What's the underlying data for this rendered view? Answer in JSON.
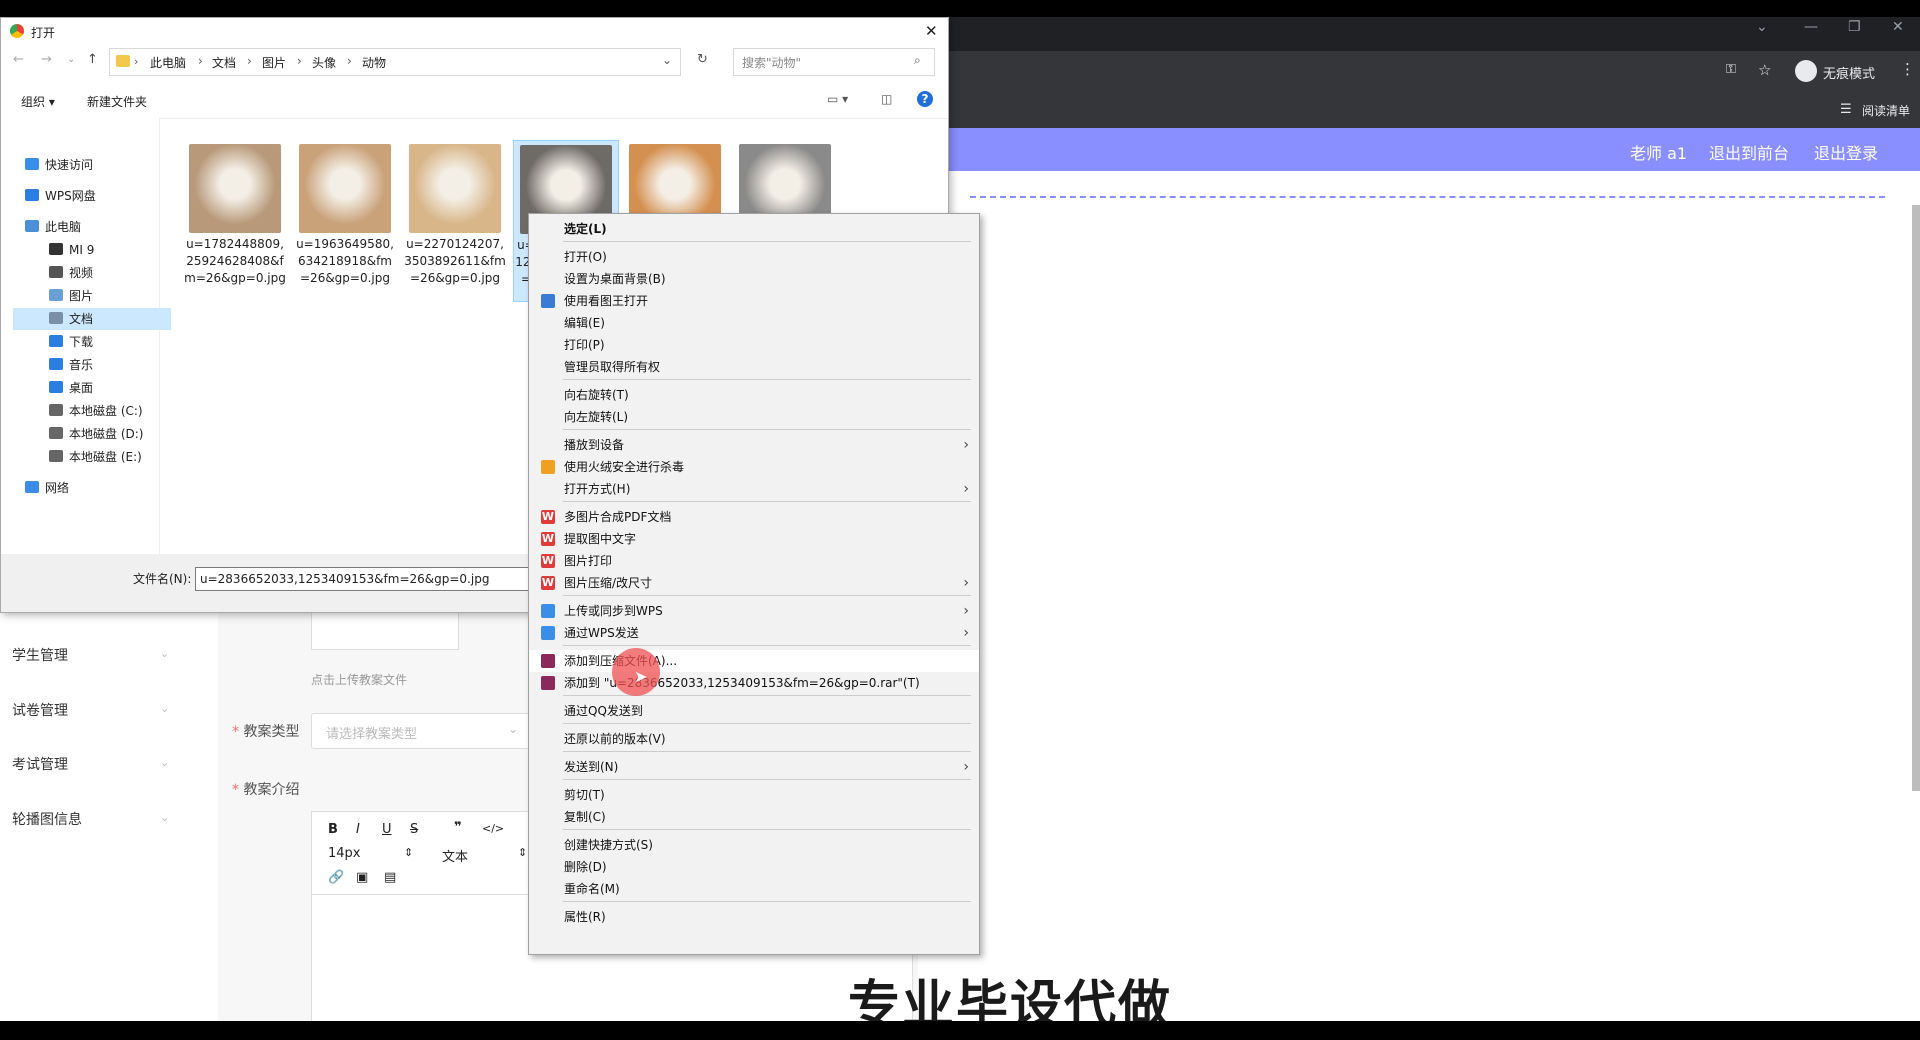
{
  "browser": {
    "incognito_label": "无痕模式",
    "reading_list": "阅读清单"
  },
  "app_header": {
    "user": "老师 a1",
    "to_front": "退出到前台",
    "logout": "退出登录"
  },
  "sidebar": {
    "items": [
      {
        "label": "学生管理"
      },
      {
        "label": "试卷管理"
      },
      {
        "label": "考试管理"
      },
      {
        "label": "轮播图信息"
      }
    ]
  },
  "form": {
    "upload_hint": "点击上传教案文件",
    "type_label": "教案类型",
    "type_placeholder": "请选择教案类型",
    "intro_label": "教案介绍",
    "editor_font_size": "14px",
    "editor_block": "文本"
  },
  "dialog": {
    "title": "打开",
    "breadcrumb": [
      "此电脑",
      "文档",
      "图片",
      "头像",
      "动物"
    ],
    "search_placeholder": "搜索\"动物\"",
    "organize": "组织",
    "new_folder": "新建文件夹",
    "filename_label": "文件名(N):",
    "filename_value": "u=2836652033,1253409153&fm=26&gp=0.jpg",
    "nav": [
      {
        "label": "快速访问",
        "icon": "star-icon",
        "color": "#3b8ee8"
      },
      {
        "label": "WPS网盘",
        "icon": "cloud-icon",
        "color": "#2a7de1"
      },
      {
        "label": "此电脑",
        "icon": "computer-icon",
        "color": "#4a90d9"
      },
      {
        "label": "MI 9",
        "icon": "phone-icon",
        "color": "#333333"
      },
      {
        "label": "视频",
        "icon": "video-icon",
        "color": "#555555"
      },
      {
        "label": "图片",
        "icon": "pictures-icon",
        "color": "#6a9fd4"
      },
      {
        "label": "文档",
        "icon": "documents-icon",
        "color": "#7b8fa8"
      },
      {
        "label": "下载",
        "icon": "download-icon",
        "color": "#2a7de1"
      },
      {
        "label": "音乐",
        "icon": "music-icon",
        "color": "#2a7de1"
      },
      {
        "label": "桌面",
        "icon": "desktop-icon",
        "color": "#2a7de1"
      },
      {
        "label": "本地磁盘 (C:)",
        "icon": "drive-icon",
        "color": "#666666"
      },
      {
        "label": "本地磁盘 (D:)",
        "icon": "drive-icon",
        "color": "#666666"
      },
      {
        "label": "本地磁盘 (E:)",
        "icon": "drive-icon",
        "color": "#666666"
      },
      {
        "label": "网络",
        "icon": "network-icon",
        "color": "#3b8ee8"
      }
    ],
    "files": [
      {
        "name": "u=1782448809,25924628408&fm=26&gp=0.jpg",
        "thumb_color": "#b89a7a"
      },
      {
        "name": "u=1963649580,634218918&fm=26&gp=0.jpg",
        "thumb_color": "#c9a27a"
      },
      {
        "name": "u=2270124207,3503892611&fm=26&gp=0.jpg",
        "thumb_color": "#d8b68a"
      },
      {
        "name": "u=2836652033,1253409153&fm=26&gp=0.jpg",
        "thumb_color": "#6e6a66"
      },
      {
        "name": "",
        "thumb_color": "#d49050"
      },
      {
        "name": "",
        "thumb_color": "#8a8a8a"
      }
    ]
  },
  "context_menu": {
    "items": [
      {
        "label": "选定(L)",
        "bold": true
      },
      {
        "sep": true
      },
      {
        "label": "打开(O)"
      },
      {
        "label": "设置为桌面背景(B)"
      },
      {
        "label": "使用看图王打开",
        "icon": "viewer-icon",
        "color": "#3a7bd5"
      },
      {
        "label": "编辑(E)"
      },
      {
        "label": "打印(P)"
      },
      {
        "label": "管理员取得所有权"
      },
      {
        "sep": true
      },
      {
        "label": "向右旋转(T)"
      },
      {
        "label": "向左旋转(L)"
      },
      {
        "sep": true
      },
      {
        "label": "播放到设备",
        "submenu": true
      },
      {
        "label": "使用火绒安全进行杀毒",
        "icon": "huorong-icon",
        "color": "#f0a020"
      },
      {
        "label": "打开方式(H)",
        "submenu": true
      },
      {
        "sep": true
      },
      {
        "label": "多图片合成PDF文档",
        "icon": "wps-icon",
        "color": "#e03b3b"
      },
      {
        "label": "提取图中文字",
        "icon": "wps-icon",
        "color": "#e03b3b"
      },
      {
        "label": "图片打印",
        "icon": "wps-icon",
        "color": "#e03b3b"
      },
      {
        "label": "图片压缩/改尺寸",
        "icon": "wps-icon",
        "color": "#e03b3b",
        "submenu": true
      },
      {
        "sep": true
      },
      {
        "label": "上传或同步到WPS",
        "icon": "wps-cloud-icon",
        "color": "#3b8ee8",
        "submenu": true
      },
      {
        "label": "通过WPS发送",
        "icon": "wps-send-icon",
        "color": "#3b8ee8",
        "submenu": true
      },
      {
        "sep": true
      },
      {
        "label": "添加到压缩文件(A)...",
        "icon": "winrar-icon",
        "color": "#8b2a5a",
        "hover": true
      },
      {
        "label": "添加到 \"u=2836652033,1253409153&fm=26&gp=0.rar\"(T)",
        "icon": "winrar-icon",
        "color": "#8b2a5a"
      },
      {
        "sep": true
      },
      {
        "label": "通过QQ发送到"
      },
      {
        "sep": true
      },
      {
        "label": "还原以前的版本(V)"
      },
      {
        "sep": true
      },
      {
        "label": "发送到(N)",
        "submenu": true
      },
      {
        "sep": true
      },
      {
        "label": "剪切(T)"
      },
      {
        "label": "复制(C)"
      },
      {
        "sep": true
      },
      {
        "label": "创建快捷方式(S)"
      },
      {
        "label": "删除(D)"
      },
      {
        "label": "重命名(M)"
      },
      {
        "sep": true
      },
      {
        "label": "属性(R)"
      }
    ]
  },
  "watermark": "专业毕设代做"
}
